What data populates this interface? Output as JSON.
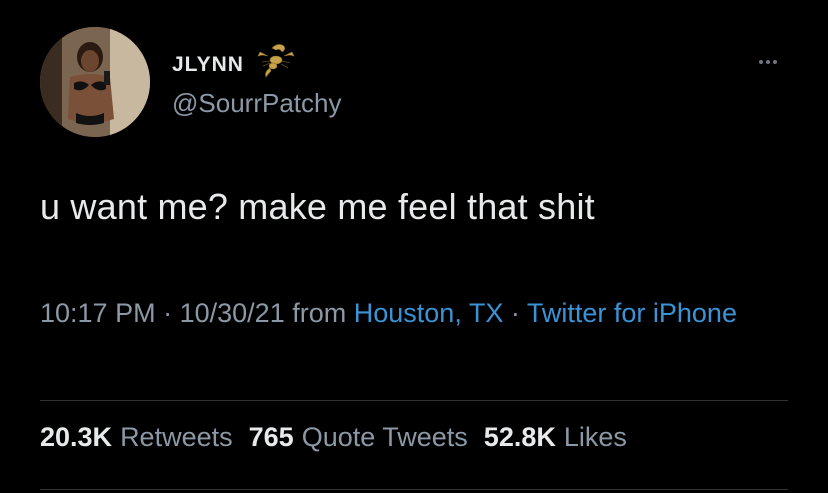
{
  "user": {
    "display_name": "JLYNN",
    "handle": "@SourrPatchy",
    "avatar_icon": "profile-photo",
    "name_emoji_icon": "scorpion-icon"
  },
  "tweet": {
    "text": "u want me? make me feel that shit",
    "time": "10:17 PM",
    "date": "10/30/21",
    "from_label": "from",
    "location": "Houston, TX",
    "separator": "·",
    "client": "Twitter for iPhone"
  },
  "stats": [
    {
      "count": "20.3K",
      "label": "Retweets"
    },
    {
      "count": "765",
      "label": "Quote Tweets"
    },
    {
      "count": "52.8K",
      "label": "Likes"
    }
  ],
  "colors": {
    "background": "#000000",
    "text": "#e7e9ea",
    "muted": "#8b98a5",
    "link": "#3a93d6",
    "divider": "#2f3336"
  }
}
